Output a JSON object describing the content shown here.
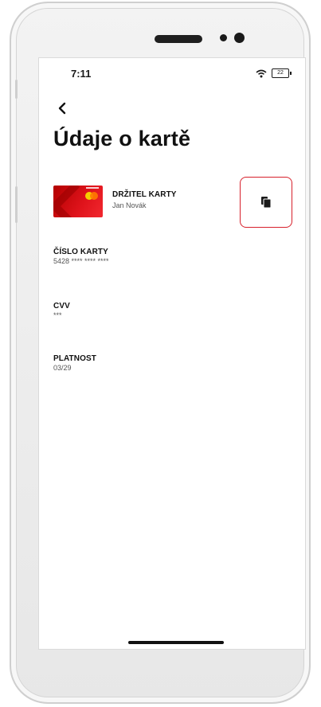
{
  "status_bar": {
    "time": "7:11",
    "battery": "22"
  },
  "header": {
    "title": "Údaje o kartě"
  },
  "card": {
    "holder_label": "DRŽITEL KARTY",
    "holder_name": "Jan Novák"
  },
  "fields": [
    {
      "label": "ČÍSLO KARTY",
      "value": "5428 **** **** ****"
    },
    {
      "label": "CVV",
      "value": "***"
    },
    {
      "label": "PLATNOST",
      "value": "03/29"
    }
  ],
  "colors": {
    "accent": "#d7202b",
    "card": "#e0141c",
    "text": "#111111",
    "muted": "#555555"
  },
  "icons": {
    "back": "chevron-left-icon",
    "copy": "copy-icon",
    "wifi": "wifi-icon",
    "battery": "battery-icon"
  }
}
